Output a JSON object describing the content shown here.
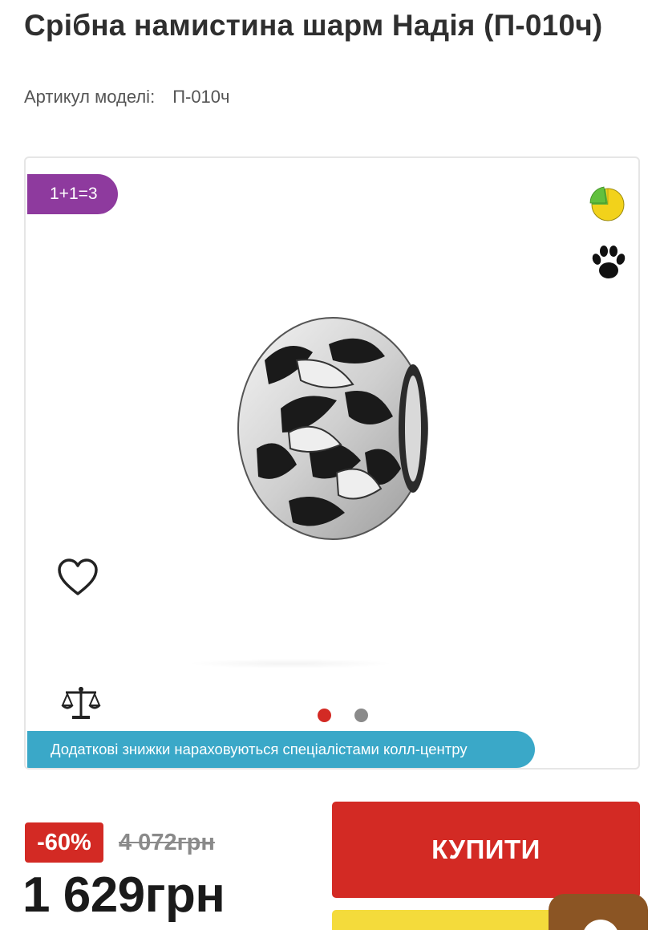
{
  "product": {
    "title": "Срібна намистина шарм Надія (П-010ч)",
    "sku_label": "Артикул моделі:",
    "sku_value": "П-010ч"
  },
  "gallery": {
    "promo_badge": "1+1=3",
    "info_banner": "Додаткові знижки нараховуються спеціалістами колл-центру",
    "slide_count": 2,
    "active_slide": 1,
    "icons": [
      "pie-chart-icon",
      "paw-icon",
      "heart-icon",
      "scales-icon"
    ]
  },
  "pricing": {
    "discount": "-60%",
    "old_price": "4 072грн",
    "current_price": "1 629грн"
  },
  "actions": {
    "buy_label": "КУПИТИ"
  },
  "colors": {
    "accent_red": "#d32a24",
    "promo_purple": "#8e3a9e",
    "banner_blue": "#3aa8c8",
    "secondary_yellow": "#f4db3b",
    "chat_brown": "#8b5524"
  }
}
